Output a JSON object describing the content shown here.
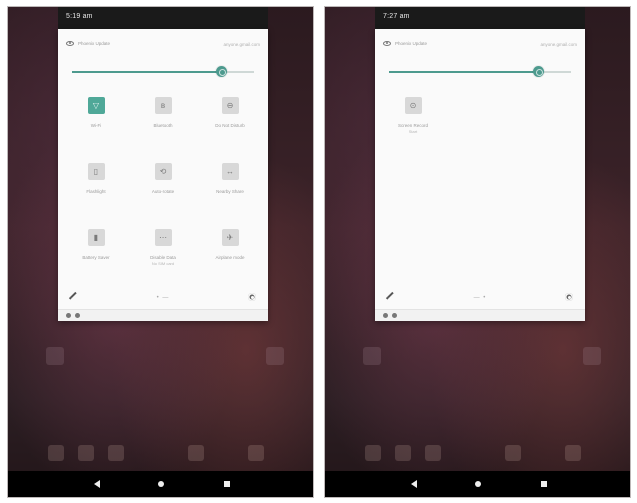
{
  "left": {
    "status_time": "5:19 am",
    "header_label": "Phoenix Update",
    "header_right": "anyone.gmail.com",
    "brightness_level": 0.82,
    "tiles": [
      {
        "label": "Wi-Fi",
        "sub": "",
        "icon": "wifi-icon",
        "active": true,
        "glyph": "▽"
      },
      {
        "label": "Bluetooth",
        "sub": "",
        "icon": "bluetooth-icon",
        "active": false,
        "glyph": "ʙ"
      },
      {
        "label": "Do Not Disturb",
        "sub": "",
        "icon": "do-not-disturb-icon",
        "active": false,
        "glyph": "⊖"
      },
      {
        "label": "Flashlight",
        "sub": "",
        "icon": "flashlight-icon",
        "active": false,
        "glyph": "▯"
      },
      {
        "label": "Auto-rotate",
        "sub": "",
        "icon": "auto-rotate-icon",
        "active": false,
        "glyph": "⟲"
      },
      {
        "label": "Nearby Share",
        "sub": "",
        "icon": "nearby-share-icon",
        "active": false,
        "glyph": "↔"
      },
      {
        "label": "Battery Saver",
        "sub": "",
        "icon": "battery-icon",
        "active": false,
        "glyph": "▮"
      },
      {
        "label": "Disable Data",
        "sub": "No SIM card",
        "icon": "data-icon",
        "active": false,
        "glyph": "⋯"
      },
      {
        "label": "Airplane mode",
        "sub": "",
        "icon": "airplane-icon",
        "active": false,
        "glyph": "✈"
      }
    ],
    "page_indicator": "• —"
  },
  "right": {
    "status_time": "7:27 am",
    "header_label": "Phoenix Update",
    "header_right": "anyone.gmail.com",
    "brightness_level": 0.82,
    "tiles": [
      {
        "label": "Screen Record",
        "sub": "Start",
        "icon": "screen-record-icon",
        "active": false,
        "glyph": "⊙"
      }
    ],
    "page_indicator": "— •"
  },
  "colors": {
    "accent": "#4d9a8e",
    "panel": "#fafafa",
    "nav_bar": "#000000"
  }
}
